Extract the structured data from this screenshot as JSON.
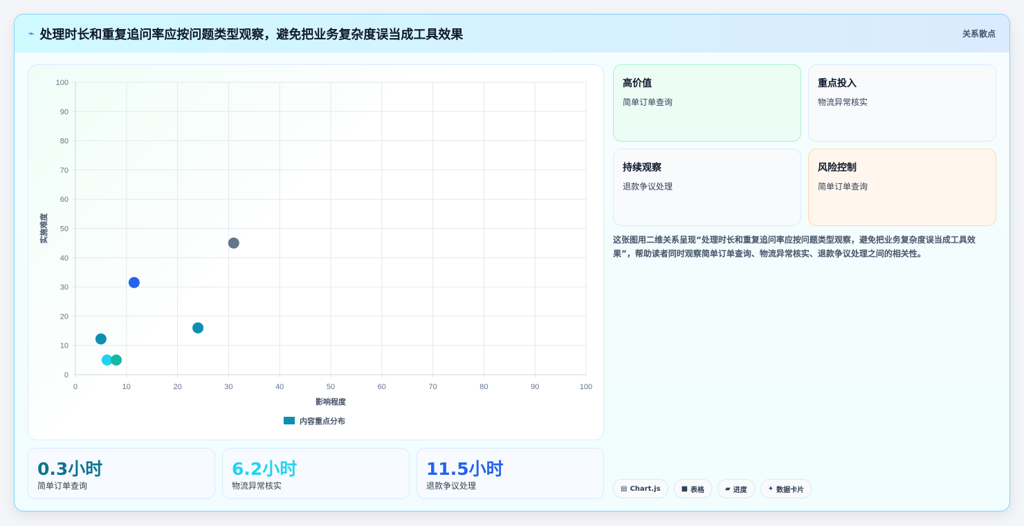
{
  "header": {
    "title": "处理时长和重复追问率应按问题类型观察，避免把业务复杂度误当成工具效果",
    "tag": "关系散点"
  },
  "chart_data": {
    "type": "scatter",
    "xlabel": "影响程度",
    "ylabel": "实施难度",
    "xlim": [
      0,
      100
    ],
    "ylim": [
      0,
      100
    ],
    "xticks": [
      0,
      10,
      20,
      30,
      40,
      50,
      60,
      70,
      80,
      90,
      100
    ],
    "yticks": [
      0,
      10,
      20,
      30,
      40,
      50,
      60,
      70,
      80,
      90,
      100
    ],
    "grid": true,
    "legend": {
      "label": "内容重点分布",
      "position": "bottom",
      "color": "#0e8fb0"
    },
    "points": [
      {
        "x": 5,
        "y": 12.2,
        "color": "#0e8fb0"
      },
      {
        "x": 6.2,
        "y": 5,
        "color": "#22d3ee"
      },
      {
        "x": 8,
        "y": 5,
        "color": "#14b8a6"
      },
      {
        "x": 11.5,
        "y": 31.5,
        "color": "#2563eb"
      },
      {
        "x": 24,
        "y": 16,
        "color": "#0e8fb0"
      },
      {
        "x": 31,
        "y": 45,
        "color": "#64748b"
      }
    ]
  },
  "stats": [
    {
      "value": "0.3小时",
      "label": "简单订单查询",
      "color": "#0e7490"
    },
    {
      "value": "6.2小时",
      "label": "物流异常核实",
      "color": "#22d3ee"
    },
    {
      "value": "11.5小时",
      "label": "退款争议处理",
      "color": "#2563eb"
    }
  ],
  "quadrants": [
    {
      "title": "高价值",
      "value": "简单订单查询",
      "bg": "#ecfdf5",
      "border": "#a7f3d0"
    },
    {
      "title": "重点投入",
      "value": "物流异常核实",
      "bg": "#f8fafc",
      "border": "#dbeafe"
    },
    {
      "title": "持续观察",
      "value": "退款争议处理",
      "bg": "#f8fafc",
      "border": "#dbeafe"
    },
    {
      "title": "风险控制",
      "value": "简单订单查询",
      "bg": "#fff7ed",
      "border": "#fed7aa"
    }
  ],
  "description": "这张图用二维关系呈现“处理时长和重复追问率应按问题类型观察，避免把业务复杂度误当成工具效果”，帮助读者同时观察简单订单查询、物流异常核实、退款争议处理之间的相关性。",
  "chips": [
    {
      "icon": "▤",
      "icon_name": "chart-icon",
      "label": "Chart.js"
    },
    {
      "icon": "■",
      "icon_name": "table-icon",
      "label": "表格"
    },
    {
      "icon": "▰",
      "icon_name": "progress-icon",
      "label": "进度"
    },
    {
      "icon": "✦",
      "icon_name": "sparkle-icon",
      "label": "数据卡片"
    }
  ]
}
